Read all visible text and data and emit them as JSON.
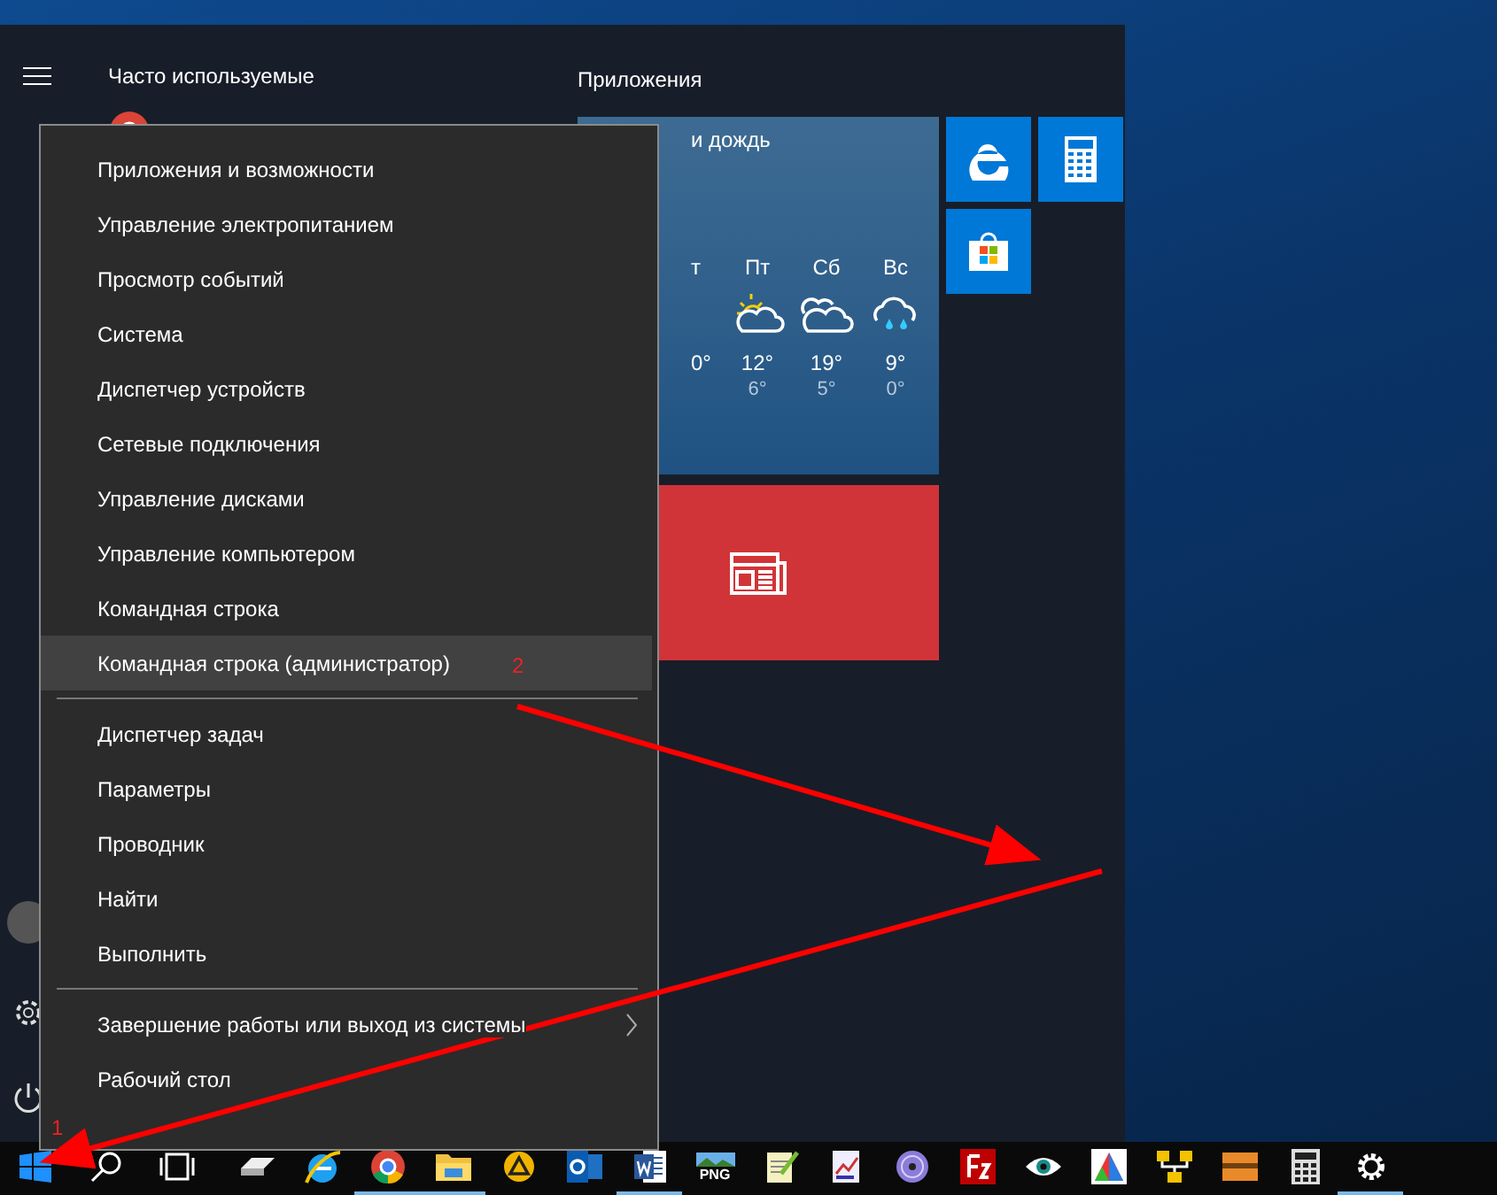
{
  "start_menu": {
    "frequent_header": "Часто используемые",
    "apps_header": "Приложения",
    "weather_tile": {
      "summary": "и дождь",
      "days": [
        {
          "day": "т",
          "high": "0°"
        },
        {
          "day": "Пт",
          "kind": "sun-cloud",
          "high": "12°",
          "low": "6°"
        },
        {
          "day": "Сб",
          "kind": "clouds",
          "high": "19°",
          "low": "5°"
        },
        {
          "day": "Вс",
          "kind": "rain-cloud",
          "high": "9°",
          "low": "0°"
        }
      ]
    }
  },
  "context_menu": {
    "groups": [
      [
        {
          "label": "Приложения и возможности",
          "selected": false,
          "submenu": false
        },
        {
          "label": "Управление электропитанием",
          "selected": false,
          "submenu": false
        },
        {
          "label": "Просмотр событий",
          "selected": false,
          "submenu": false
        },
        {
          "label": "Система",
          "selected": false,
          "submenu": false
        },
        {
          "label": "Диспетчер устройств",
          "selected": false,
          "submenu": false
        },
        {
          "label": "Сетевые подключения",
          "selected": false,
          "submenu": false
        },
        {
          "label": "Управление дисками",
          "selected": false,
          "submenu": false
        },
        {
          "label": "Управление компьютером",
          "selected": false,
          "submenu": false
        },
        {
          "label": "Командная строка",
          "selected": false,
          "submenu": false
        },
        {
          "label": "Командная строка (администратор)",
          "selected": true,
          "submenu": false
        }
      ],
      [
        {
          "label": "Диспетчер задач",
          "selected": false,
          "submenu": false
        },
        {
          "label": "Параметры",
          "selected": false,
          "submenu": false
        },
        {
          "label": "Проводник",
          "selected": false,
          "submenu": false
        },
        {
          "label": "Найти",
          "selected": false,
          "submenu": false
        },
        {
          "label": "Выполнить",
          "selected": false,
          "submenu": false
        }
      ],
      [
        {
          "label": "Завершение работы или выход из системы",
          "selected": false,
          "submenu": true
        },
        {
          "label": "Рабочий стол",
          "selected": false,
          "submenu": false
        }
      ]
    ]
  },
  "taskbar": {
    "apps": [
      {
        "kind": "eraser",
        "running": false
      },
      {
        "kind": "e-logo",
        "running": false
      },
      {
        "kind": "round-logo",
        "running": true
      },
      {
        "kind": "folder",
        "running": true
      },
      {
        "kind": "triangle",
        "running": false
      },
      {
        "kind": "mail",
        "running": false
      },
      {
        "kind": "document",
        "running": true
      },
      {
        "kind": "image-file",
        "running": false,
        "label": "PNG"
      },
      {
        "kind": "notepad",
        "running": false
      },
      {
        "kind": "chart",
        "running": false
      },
      {
        "kind": "disc",
        "running": false
      },
      {
        "kind": "lettered-square",
        "running": false
      },
      {
        "kind": "eye",
        "running": false
      },
      {
        "kind": "triangles",
        "running": false
      },
      {
        "kind": "network",
        "running": false
      },
      {
        "kind": "box",
        "running": false
      },
      {
        "kind": "calculator",
        "running": false
      },
      {
        "kind": "gear",
        "running": true
      }
    ]
  },
  "annotations": [
    {
      "label": "1"
    },
    {
      "label": "2"
    }
  ]
}
